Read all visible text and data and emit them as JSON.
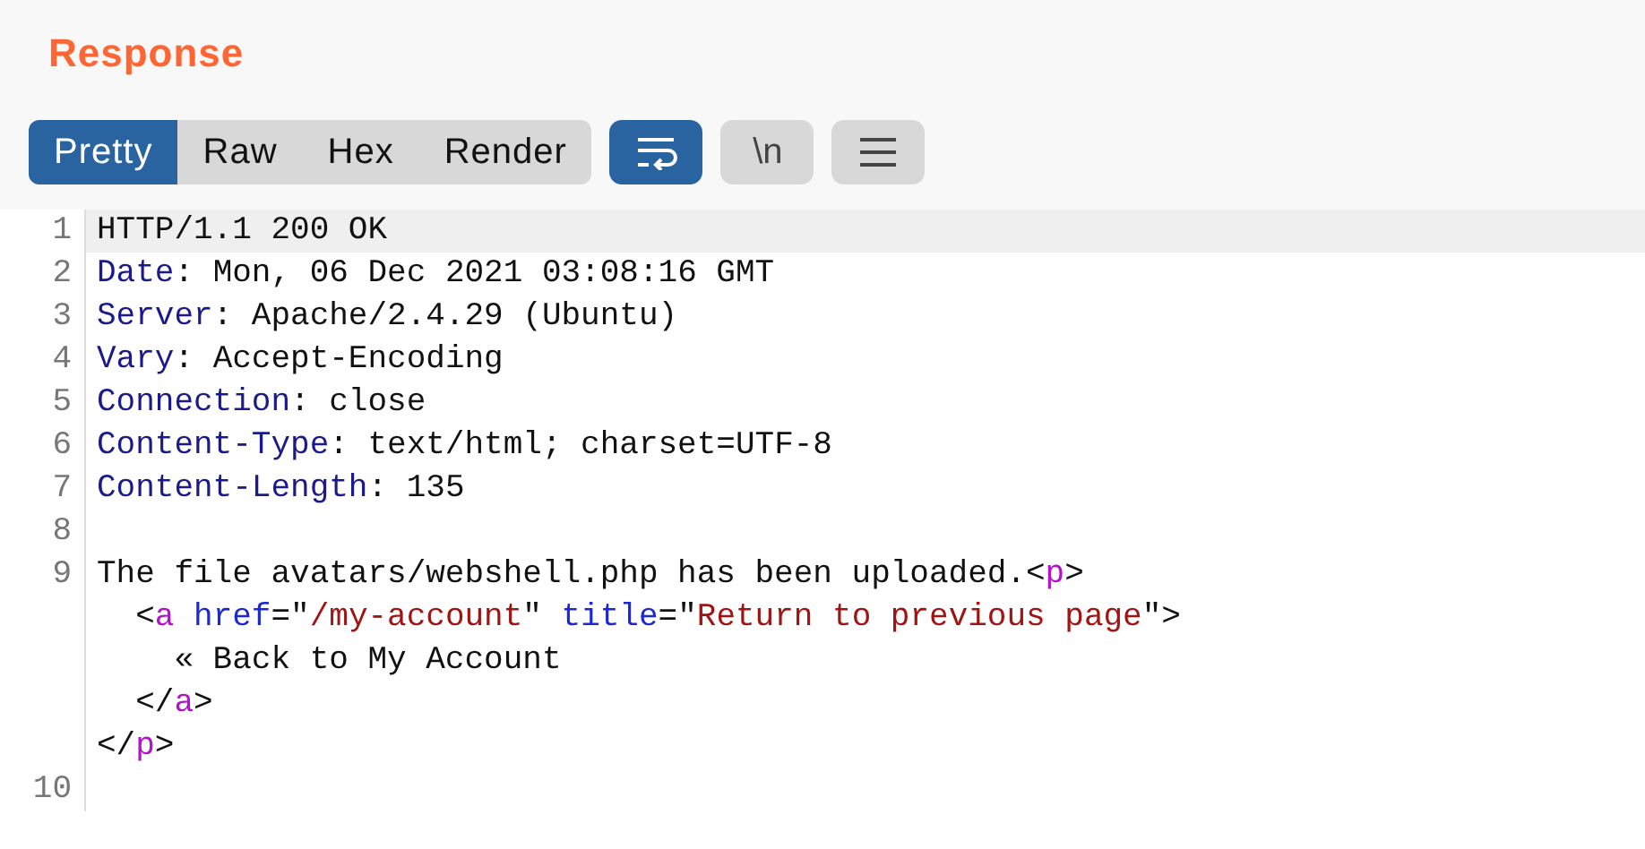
{
  "panel": {
    "title": "Response"
  },
  "view_tabs": [
    {
      "label": "Pretty",
      "selected": true
    },
    {
      "label": "Raw",
      "selected": false
    },
    {
      "label": "Hex",
      "selected": false
    },
    {
      "label": "Render",
      "selected": false
    }
  ],
  "toolbar_toggles": [
    {
      "kind": "wrap",
      "selected": true
    },
    {
      "kind": "newline",
      "label": "\\n",
      "selected": false
    },
    {
      "kind": "menu",
      "selected": false
    }
  ],
  "editor": {
    "lines": [
      {
        "number": "1",
        "highlighted": true,
        "tokens": [
          {
            "kind": "plain",
            "text": "HTTP/1.1 200 OK"
          }
        ]
      },
      {
        "number": "2",
        "highlighted": false,
        "tokens": [
          {
            "kind": "key",
            "text": "Date"
          },
          {
            "kind": "plain",
            "text": ": Mon, 06 Dec 2021 03:08:16 GMT"
          }
        ]
      },
      {
        "number": "3",
        "highlighted": false,
        "tokens": [
          {
            "kind": "key",
            "text": "Server"
          },
          {
            "kind": "plain",
            "text": ": Apache/2.4.29 (Ubuntu)"
          }
        ]
      },
      {
        "number": "4",
        "highlighted": false,
        "tokens": [
          {
            "kind": "key",
            "text": "Vary"
          },
          {
            "kind": "plain",
            "text": ": Accept-Encoding"
          }
        ]
      },
      {
        "number": "5",
        "highlighted": false,
        "tokens": [
          {
            "kind": "key",
            "text": "Connection"
          },
          {
            "kind": "plain",
            "text": ": close"
          }
        ]
      },
      {
        "number": "6",
        "highlighted": false,
        "tokens": [
          {
            "kind": "key",
            "text": "Content-Type"
          },
          {
            "kind": "plain",
            "text": ": text/html; charset=UTF-8"
          }
        ]
      },
      {
        "number": "7",
        "highlighted": false,
        "tokens": [
          {
            "kind": "key",
            "text": "Content-Length"
          },
          {
            "kind": "plain",
            "text": ": 135"
          }
        ]
      },
      {
        "number": "8",
        "highlighted": false
      },
      {
        "number": "9",
        "highlighted": false,
        "tokens": [
          {
            "kind": "plain",
            "text": "The file avatars/webshell.php has been uploaded.<"
          },
          {
            "kind": "tag",
            "text": "p"
          },
          {
            "kind": "plain",
            "text": ">"
          }
        ]
      },
      {
        "highlighted": false,
        "tokens": [
          {
            "kind": "plain",
            "text": "  <"
          },
          {
            "kind": "tag",
            "text": "a"
          },
          {
            "kind": "attr",
            "text": " href"
          },
          {
            "kind": "plain",
            "text": "=\""
          },
          {
            "kind": "value",
            "text": "/my-account"
          },
          {
            "kind": "plain",
            "text": "\" "
          },
          {
            "kind": "attr",
            "text": "title"
          },
          {
            "kind": "plain",
            "text": "=\""
          },
          {
            "kind": "value",
            "text": "Return to previous page"
          },
          {
            "kind": "plain",
            "text": "\">"
          }
        ]
      },
      {
        "highlighted": false,
        "tokens": [
          {
            "kind": "plain",
            "text": "    « Back to My Account"
          }
        ]
      },
      {
        "highlighted": false,
        "tokens": [
          {
            "kind": "plain",
            "text": "  </"
          },
          {
            "kind": "tag",
            "text": "a"
          },
          {
            "kind": "plain",
            "text": ">"
          }
        ]
      },
      {
        "highlighted": false,
        "tokens": [
          {
            "kind": "plain",
            "text": "</"
          },
          {
            "kind": "tag",
            "text": "p"
          },
          {
            "kind": "plain",
            "text": ">"
          }
        ]
      },
      {
        "number": "10",
        "highlighted": false
      }
    ]
  }
}
